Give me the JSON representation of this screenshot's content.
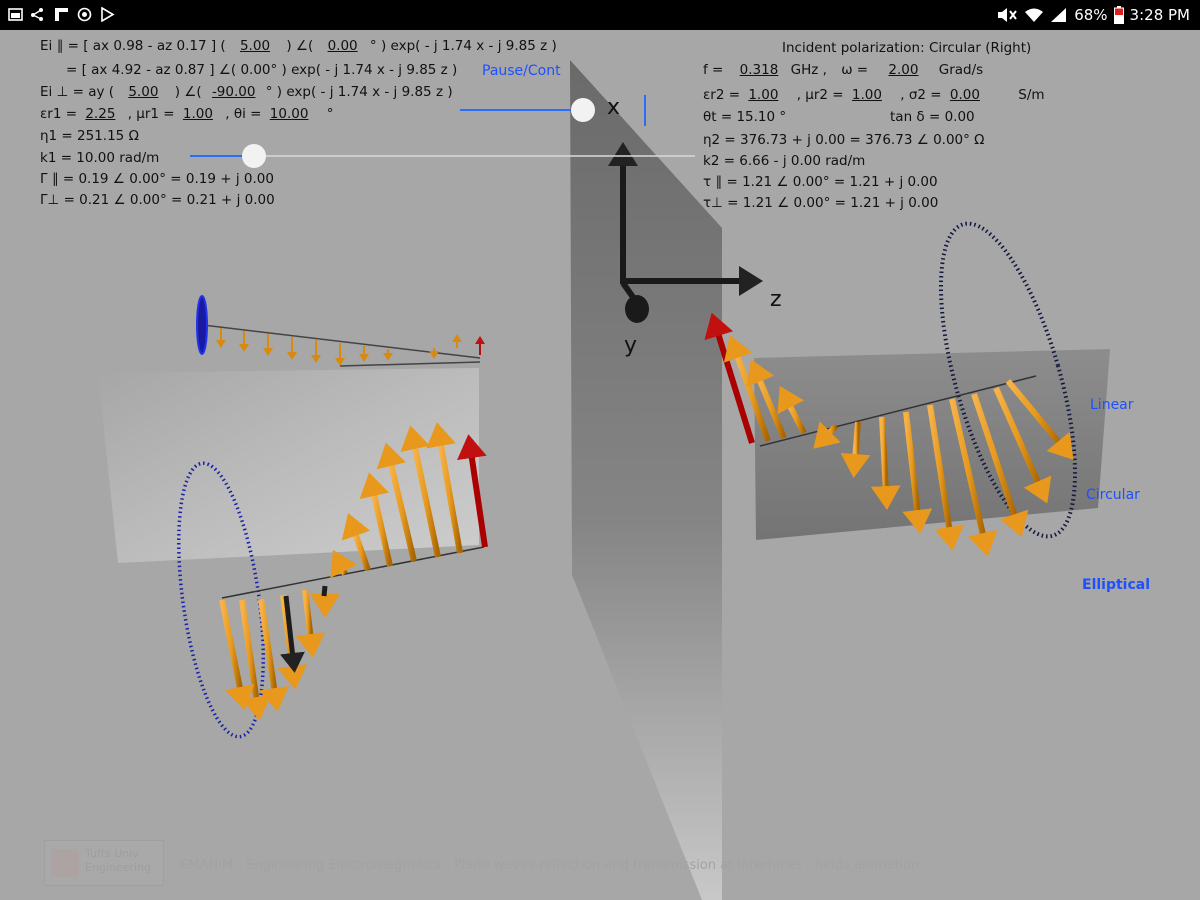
{
  "status_bar": {
    "battery": "68%",
    "time": "3:28 PM"
  },
  "controls": {
    "pause_label": "Pause/Cont",
    "linear_label": "Linear",
    "circular_label": "Circular",
    "elliptical_label": "Elliptical"
  },
  "left_panel": {
    "ei_par_l1_a": "Ei ∥ = [ ax  0.98 - az  0.17 ] (",
    "ei_par_amp": "5.00",
    "ei_par_l1_b": ") ∠(",
    "ei_par_phase": "0.00",
    "ei_par_l1_c": "° ) exp( - j 1.74 x - j 9.85 z )",
    "ei_par_l2": "= [ ax 4.92 - az 0.87 ] ∠( 0.00° ) exp( - j 1.74 x - j 9.85 z )",
    "ei_perp_a": "Ei ⊥ = ay (",
    "ei_perp_amp": "5.00",
    "ei_perp_b": ") ∠(",
    "ei_perp_phase": "-90.00",
    "ei_perp_c": "° ) exp( - j 1.74 x - j 9.85 z )",
    "er1_label": "εr1 =",
    "er1_value": "2.25",
    "ur1_label": ",     μr1 =",
    "ur1_value": "1.00",
    "thi_label": ",     θi =",
    "thi_value": "10.00",
    "thi_unit": "°",
    "eta1": "η1 = 251.15  Ω",
    "k1": "k1 = 10.00  rad/m",
    "gamma_par": "Γ ∥ = 0.19 ∠ 0.00°  = 0.19 + j 0.00",
    "gamma_perp": "Γ⊥ = 0.21 ∠ 0.00°  = 0.21 + j 0.00"
  },
  "right_panel": {
    "polarization": "Incident polarization: Circular (Right)",
    "f_label": "f =",
    "f_value": "0.318",
    "f_unit": "GHz ,",
    "w_label": "ω =",
    "w_value": "2.00",
    "w_unit": "Grad/s",
    "er2_label": "εr2 =",
    "er2_value": "1.00",
    "ur2_label": ",      μr2 =",
    "ur2_value": "1.00",
    "s2_label": ",      σ2 =",
    "s2_value": "0.00",
    "s2_unit": "S/m",
    "tht": "θt = 15.10 °",
    "tand": "tan δ = 0.00",
    "eta2": "η2 = 376.73 + j 0.00 = 376.73 ∠ 0.00°  Ω",
    "k2": "k2 = 6.66 - j 0.00  rad/m",
    "tau_par": "τ ∥ = 1.21 ∠ 0.00°  = 1.21 + j 0.00",
    "tau_perp": "τ⊥ = 1.21 ∠ 0.00°  = 1.21 + j 0.00"
  },
  "axes": {
    "x": "x",
    "y": "y",
    "z": "z"
  },
  "footer": {
    "logo_line1": "Tufts Univ",
    "logo_line2": "Engineering",
    "text": "EMANIM - Engineering Electromagnetics - Plane waves reflection and transmission at interfaces - fields animation"
  }
}
